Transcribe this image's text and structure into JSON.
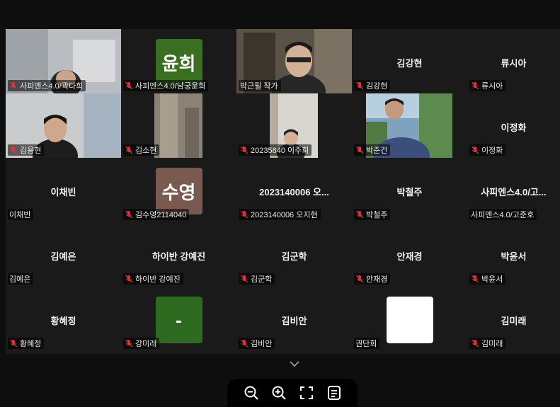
{
  "participants": [
    {
      "label": "사피엔스4.0/곽다희",
      "muted": true
    },
    {
      "label": "사피엔스4.0/남궁윤희",
      "muted": true,
      "avatar_text": "윤희",
      "avatar_color": "#3a6f22"
    },
    {
      "label": "박근필 작가",
      "muted": false
    },
    {
      "label": "김강현",
      "muted": true,
      "center_name": "김강현"
    },
    {
      "label": "류시아",
      "muted": true,
      "center_name": "류시아"
    },
    {
      "label": "김용현",
      "muted": true
    },
    {
      "label": "김소현",
      "muted": true
    },
    {
      "label": "20235840 이주희",
      "muted": true
    },
    {
      "label": "박준건",
      "muted": true
    },
    {
      "label": "이정화",
      "muted": true,
      "center_name": "이정화"
    },
    {
      "label": "이채빈",
      "muted": false,
      "center_name": "이채빈"
    },
    {
      "label": "김수영2114040",
      "muted": true,
      "avatar_text": "수영",
      "avatar_color": "#7a5a4e"
    },
    {
      "label": "2023140006 오지현",
      "muted": true,
      "center_name": "2023140006 오..."
    },
    {
      "label": "박철주",
      "muted": true,
      "center_name": "박철주"
    },
    {
      "label": "사피엔스4.0/고준호",
      "muted": false,
      "center_name": "사피엔스4.0/고..."
    },
    {
      "label": "김예은",
      "muted": false,
      "center_name": "김예은"
    },
    {
      "label": "하이반 강예진",
      "muted": true,
      "center_name": "하이반 강예진"
    },
    {
      "label": "김군학",
      "muted": true,
      "center_name": "김군학"
    },
    {
      "label": "안재경",
      "muted": true,
      "center_name": "안재경"
    },
    {
      "label": "박윤서",
      "muted": true,
      "center_name": "박윤서"
    },
    {
      "label": "황혜정",
      "muted": true,
      "center_name": "황혜정"
    },
    {
      "label": "강미래",
      "muted": true,
      "avatar_text": "-",
      "avatar_color": "#2e6a1f"
    },
    {
      "label": "김비안",
      "muted": true,
      "center_name": "김비안"
    },
    {
      "label": "권단희",
      "muted": false,
      "avatar_text": "",
      "avatar_color": "#ffffff"
    },
    {
      "label": "김미래",
      "muted": true,
      "center_name": "김미래"
    }
  ],
  "toolbar": {
    "icons": [
      "zoom-out-icon",
      "zoom-in-icon",
      "fullscreen-icon",
      "notes-icon"
    ]
  },
  "colors": {
    "active_speaker": "#27c281",
    "muted_mic": "#e0323a"
  }
}
